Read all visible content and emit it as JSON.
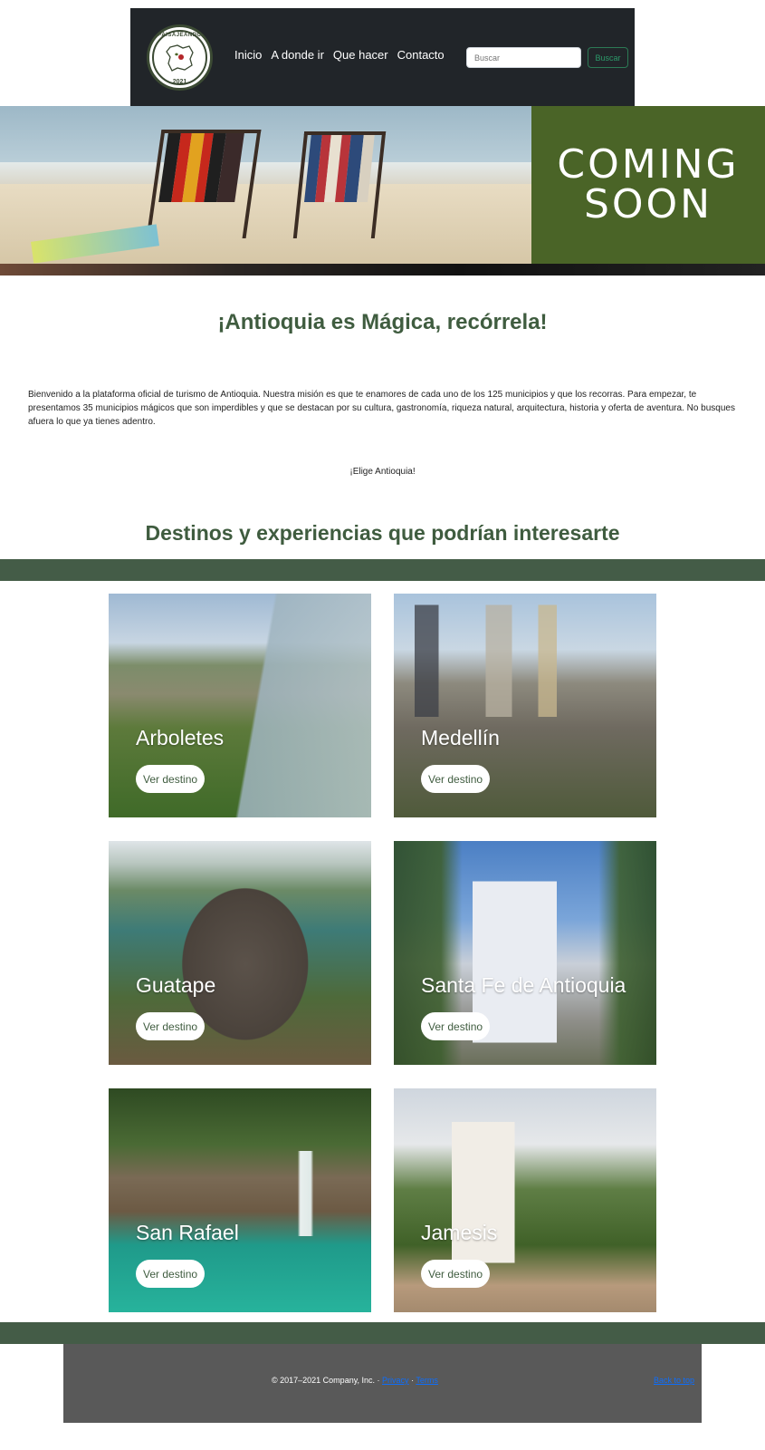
{
  "brand": {
    "logo_top_text": "PAISAJEANDO",
    "logo_year": "2021"
  },
  "nav": {
    "links": [
      "Inicio",
      "A donde ir",
      "Que hacer",
      "Contacto"
    ],
    "search_placeholder": "Buscar",
    "search_button": "Buscar"
  },
  "hero": {
    "coming_line1": "COMING",
    "coming_line2": "SOON",
    "panel_color": "#4a6427"
  },
  "main": {
    "title": "¡Antioquia es Mágica, recórrela!",
    "intro": "Bienvenido a la plataforma oficial de turismo de Antioquia. Nuestra misión es que te enamores de cada uno de los 125 municipios y que los recorras. Para empezar, te presentamos 35 municipios mágicos que son imperdibles y que se destacan por su cultura, gastronomía, riqueza natural, arquitectura, historia y oferta de aventura. No busques afuera lo que ya tienes adentro.",
    "tagline": "¡Elige Antioquia!",
    "section_title": "Destinos y experiencias que podrían interesarte"
  },
  "destinations": [
    {
      "name": "Arboletes",
      "button": "Ver destino"
    },
    {
      "name": "Medellín",
      "button": "Ver destino"
    },
    {
      "name": "Guatape",
      "button": "Ver destino"
    },
    {
      "name": "Santa Fe de Antioquia",
      "button": "Ver destino"
    },
    {
      "name": "San Rafael",
      "button": "Ver destino"
    },
    {
      "name": "Jamesis",
      "button": "Ver destino"
    }
  ],
  "footer": {
    "copyright": "© 2017–2021 Company, Inc. · ",
    "privacy": "Privacy",
    "separator": " · ",
    "terms": "Terms",
    "back_to_top": "Back to top"
  },
  "colors": {
    "accent_green": "#3f5c3f",
    "band_green": "#445c47",
    "navbar": "#212529",
    "footer": "#595959"
  }
}
